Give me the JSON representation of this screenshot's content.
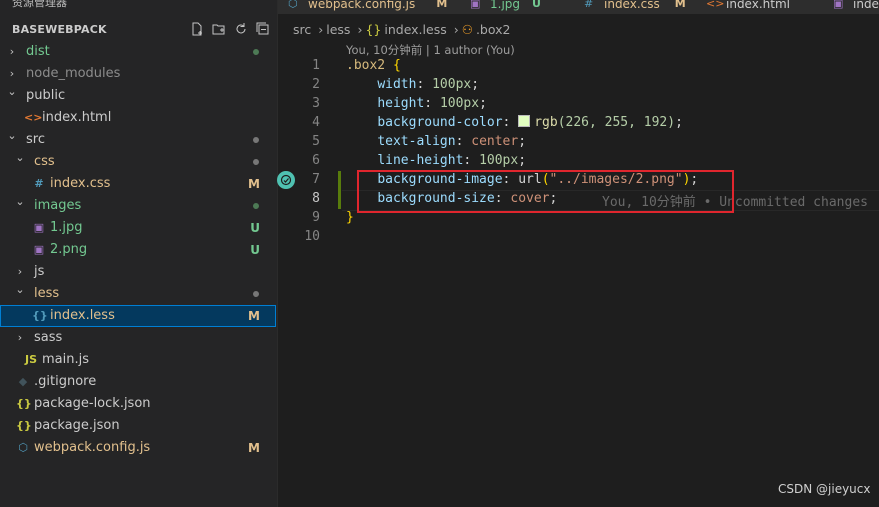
{
  "sidebar": {
    "top_title": "资源管理器",
    "more": "···",
    "project": "BASEWEBPACK",
    "items": [
      {
        "label": "dist",
        "chev": "›",
        "color": "#73c991",
        "status_dot": "#4d7a55"
      },
      {
        "label": "node_modules",
        "chev": "›",
        "color": "#8c8c8c"
      },
      {
        "label": "public",
        "chev": "⌄",
        "color": "#cccccc"
      },
      {
        "label": "index.html",
        "icon": "<>",
        "icon_color": "#e37933",
        "color": "#cccccc"
      },
      {
        "label": "src",
        "chev": "⌄",
        "color": "#cccccc",
        "status_dot": "#777777"
      },
      {
        "label": "css",
        "chev": "⌄",
        "color": "#e2c08d",
        "status_dot": "#777777"
      },
      {
        "label": "index.css",
        "icon": "#",
        "icon_color": "#519aba",
        "color": "#e2c08d",
        "badge": "M"
      },
      {
        "label": "images",
        "chev": "⌄",
        "color": "#73c991",
        "status_dot": "#4d7a55"
      },
      {
        "label": "1.jpg",
        "icon": "▣",
        "icon_color": "#a074c4",
        "color": "#73c991",
        "badge": "U"
      },
      {
        "label": "2.png",
        "icon": "▣",
        "icon_color": "#a074c4",
        "color": "#73c991",
        "badge": "U"
      },
      {
        "label": "js",
        "chev": "›",
        "color": "#cccccc"
      },
      {
        "label": "less",
        "chev": "⌄",
        "color": "#e2c08d",
        "status_dot": "#777777"
      },
      {
        "label": "index.less",
        "icon": "{}",
        "icon_color": "#519aba",
        "color": "#e2c08d",
        "badge": "M",
        "selected": true
      },
      {
        "label": "sass",
        "chev": "›",
        "color": "#cccccc"
      },
      {
        "label": "main.js",
        "icon": "JS",
        "icon_color": "#cbcb41",
        "color": "#cccccc"
      },
      {
        "label": ".gitignore",
        "icon": "◆",
        "icon_color": "#41535b",
        "color": "#cccccc"
      },
      {
        "label": "package-lock.json",
        "icon": "{}",
        "icon_color": "#cbcb41",
        "color": "#cccccc"
      },
      {
        "label": "package.json",
        "icon": "{}",
        "icon_color": "#cbcb41",
        "color": "#cccccc"
      },
      {
        "label": "webpack.config.js",
        "icon": "⬡",
        "icon_color": "#519aba",
        "color": "#e2c08d",
        "badge": "M"
      }
    ]
  },
  "tabs": [
    {
      "label": "webpack.config.js",
      "status": "M",
      "icon": "⬡",
      "icon_color": "#519aba",
      "color": "#e2c08d"
    },
    {
      "label": "1.jpg",
      "status": "U",
      "icon": "▣",
      "icon_color": "#a074c4",
      "color": "#73c991"
    },
    {
      "label": "index.css",
      "status": "M",
      "icon": "#",
      "icon_color": "#519aba",
      "color": "#e2c08d"
    },
    {
      "label": "index.html",
      "status": "",
      "icon": "<>",
      "icon_color": "#e37933",
      "color": "#cccccc"
    },
    {
      "label": "inde",
      "status": "",
      "icon": "▣",
      "icon_color": "#a074c4",
      "color": "#cccccc"
    }
  ],
  "breadcrumb": {
    "parts": [
      "src",
      "less",
      "index.less",
      ".box2"
    ]
  },
  "editor": {
    "codelens": "You, 10分钟前 | 1 author (You)",
    "line_numbers": [
      "1",
      "2",
      "3",
      "4",
      "5",
      "6",
      "7",
      "8",
      "9",
      "10"
    ],
    "lines": {
      "l1_sel": ".box2",
      "l1_brace": "{",
      "l2_prop": "width",
      "l2_val": "100px",
      "l3_prop": "height",
      "l3_val": "100px",
      "l4_prop": "background-color",
      "l4_func": "rgb",
      "l4_args": "(226, 255, 192)",
      "l5_prop": "text-align",
      "l5_val": "center",
      "l6_prop": "line-height",
      "l6_val": "100px",
      "l7_prop": "background-image",
      "l7_func": "url",
      "l7_str": "\"../images/2.png\"",
      "l8_prop": "background-size",
      "l8_val": "cover",
      "l9_brace": "}"
    },
    "swatch_color": "#e2ffc0",
    "blame": "You, 10分钟前 • Uncommitted changes"
  },
  "watermark": "CSDN @jieyucx"
}
